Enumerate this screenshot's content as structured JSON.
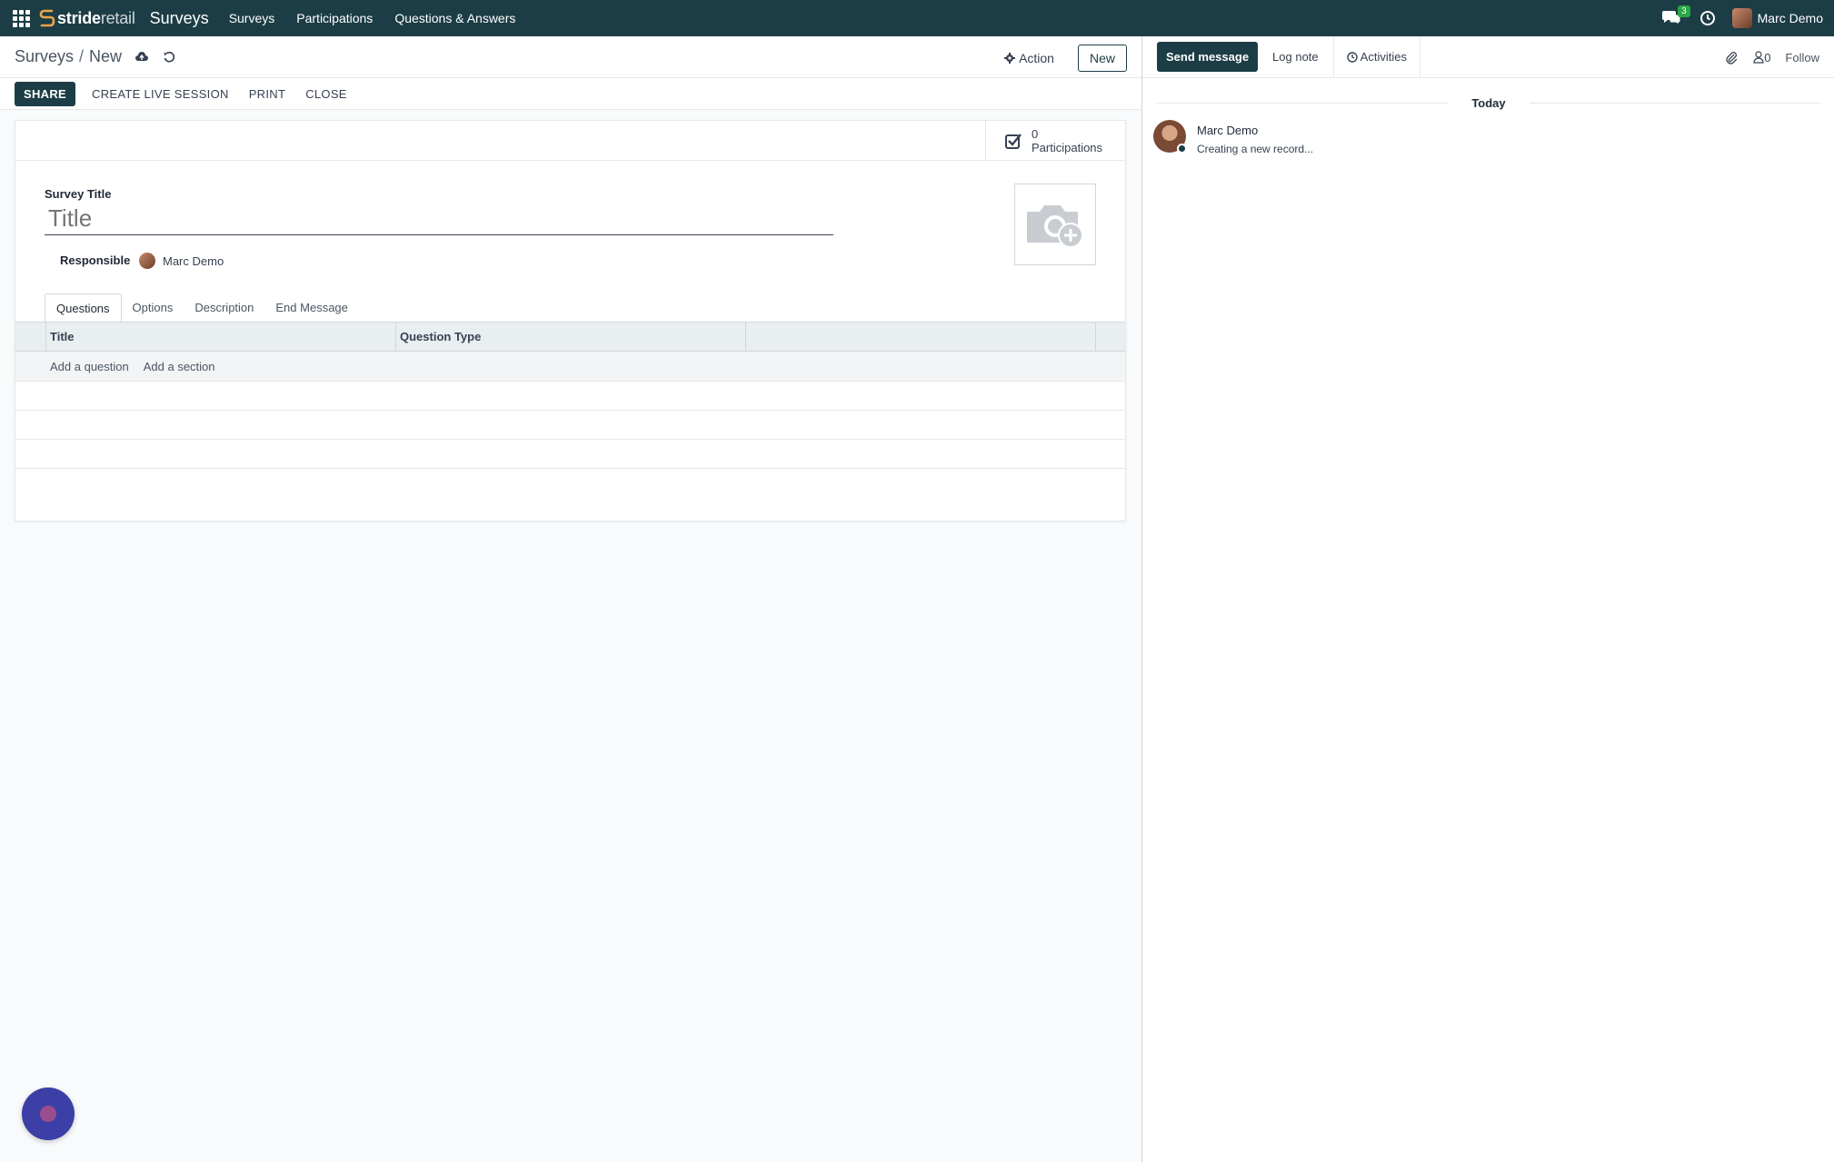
{
  "navbar": {
    "brand_bold": "stride",
    "brand_light": "retail",
    "app_name": "Surveys",
    "menu": [
      {
        "label": "Surveys"
      },
      {
        "label": "Participations"
      },
      {
        "label": "Questions & Answers"
      }
    ],
    "chat_badge": "3",
    "user_name": "Marc Demo"
  },
  "control_panel": {
    "breadcrumb_parent": "Surveys",
    "breadcrumb_sep": "/",
    "breadcrumb_current": "New",
    "action_label": "Action",
    "new_label": "New"
  },
  "statusbar": {
    "share": "SHARE",
    "create_live": "CREATE LIVE SESSION",
    "print": "PRINT",
    "close": "CLOSE"
  },
  "form": {
    "participations_count": "0",
    "participations_label": "Participations",
    "survey_title_label": "Survey Title",
    "title_placeholder": "Title",
    "responsible_label": "Responsible",
    "responsible_value": "Marc Demo",
    "tabs": [
      {
        "label": "Questions"
      },
      {
        "label": "Options"
      },
      {
        "label": "Description"
      },
      {
        "label": "End Message"
      }
    ],
    "table": {
      "col_title": "Title",
      "col_type": "Question Type",
      "add_question": "Add a question",
      "add_section": "Add a section"
    }
  },
  "chatter": {
    "send_message": "Send message",
    "log_note": "Log note",
    "activities": "Activities",
    "followers_count": "0",
    "follow": "Follow",
    "today": "Today",
    "messages": [
      {
        "author": "Marc Demo",
        "body": "Creating a new record..."
      }
    ]
  },
  "colors": {
    "navbar_bg": "#1c3d45",
    "primary": "#1c3d45",
    "badge": "#28a745"
  }
}
